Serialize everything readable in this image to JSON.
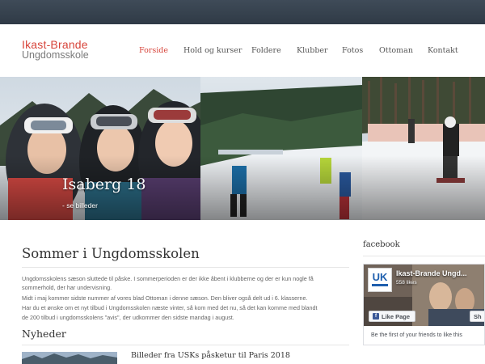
{
  "brand": {
    "line1": "Ikast-Brande",
    "line2": "Ungdomsskole",
    "accent": "#d7443a"
  },
  "nav": {
    "items": [
      {
        "label": "Forside",
        "active": true
      },
      {
        "label": "Hold og kurser",
        "active": false
      },
      {
        "label": "Foldere",
        "active": false
      },
      {
        "label": "Klubber",
        "active": false
      },
      {
        "label": "Fotos",
        "active": false
      },
      {
        "label": "Ottoman",
        "active": false
      },
      {
        "label": "Kontakt",
        "active": false
      }
    ]
  },
  "hero": {
    "title": "Isaberg 18",
    "subtitle": "- se billeder"
  },
  "main": {
    "title": "Sommer i Ungdomsskolen",
    "paragraphs": [
      "Ungdomsskolens sæson sluttede til påske. I sommerperioden er der ikke åbent i klubberne og der er kun nogle få",
      "sommerhold, der har undervisning.",
      "Midt i maj kommer sidste nummer af vores blad Ottoman i denne sæson. Den bliver også delt ud i 6. klasserne.",
      "Har du et ønske om et nyt tilbud i Ungdomsskolen næste vinter, så kom med det nu, så det kan komme med blandt",
      "de 200 tilbud i ungdomsskolens \"avis\", der udkommer den sidste mandag i august."
    ]
  },
  "news": {
    "title": "Nyheder",
    "items": [
      {
        "label": "Billeder fra USKs påsketur til Paris 2018"
      }
    ]
  },
  "sidebar": {
    "title": "facebook",
    "fb": {
      "page_name": "Ikast-Brande Ungd...",
      "likes": "558 likes",
      "like_label": "Like Page",
      "share_label": "Sh",
      "footer": "Be the first of your friends to like this",
      "brand_color": "#3b5998"
    }
  }
}
